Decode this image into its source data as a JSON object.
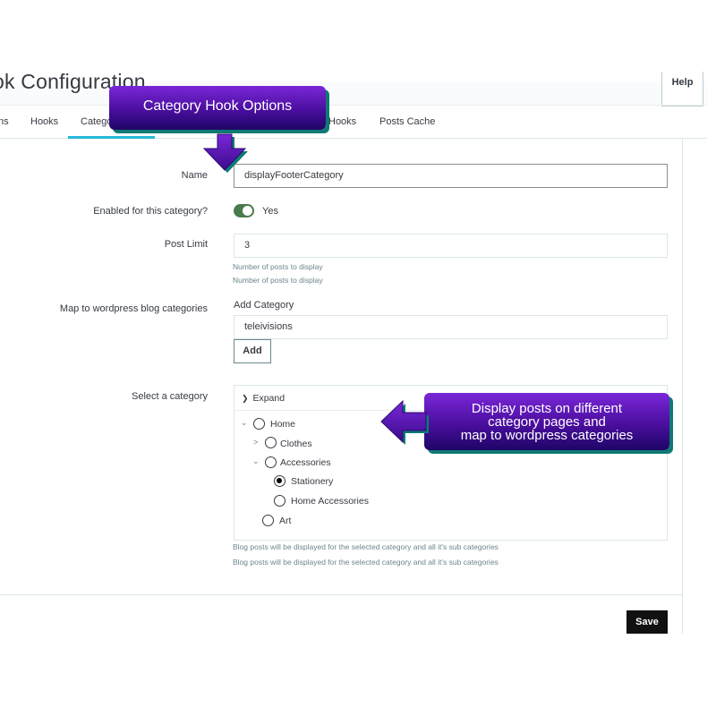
{
  "header": {
    "title": "ok Configuration",
    "help_label": "Help"
  },
  "tabs": [
    {
      "label": "ns"
    },
    {
      "label": "Hooks"
    },
    {
      "label": "Catego"
    },
    {
      "label": "Hooks"
    },
    {
      "label": "Posts Cache"
    }
  ],
  "callouts": {
    "top": "Category Hook  Options",
    "right": [
      "Display posts on different",
      "category pages and",
      "map to wordpress categories"
    ]
  },
  "form": {
    "name": {
      "label": "Name",
      "value": "displayFooterCategory"
    },
    "enabled": {
      "label": "Enabled for this category?",
      "value": "Yes",
      "on": true
    },
    "post_limit": {
      "label": "Post Limit",
      "value": "3",
      "help": [
        "Number of posts to display",
        "Number of posts to display"
      ]
    },
    "map_categories": {
      "label": "Map to wordpress blog categories",
      "add_label": "Add Category",
      "value": "teleivisions",
      "add_button": "Add"
    },
    "select_category": {
      "label": "Select a category",
      "expand_label": "Expand",
      "tree": [
        {
          "label": "Home",
          "caret": "expanded",
          "checked": false
        },
        {
          "label": "Clothes",
          "caret": "collapsed",
          "checked": false
        },
        {
          "label": "Accessories",
          "caret": "expanded",
          "checked": false
        },
        {
          "label": "Stationery",
          "caret": "none",
          "checked": true
        },
        {
          "label": "Home Accessories",
          "caret": "none",
          "checked": false
        },
        {
          "label": "Art",
          "caret": "none",
          "checked": false
        }
      ],
      "help": [
        "Blog posts will be displayed for the selected category and all it's sub categories",
        "Blog posts will be displayed for the selected category and all it's sub categories"
      ]
    }
  },
  "footer": {
    "save_label": "Save"
  },
  "colors": {
    "toggle_on": "#4a7b4b",
    "callout_purple": "#5a14b8",
    "callout_shadow": "#0e7a73",
    "tab_active": "#25b9d7"
  }
}
